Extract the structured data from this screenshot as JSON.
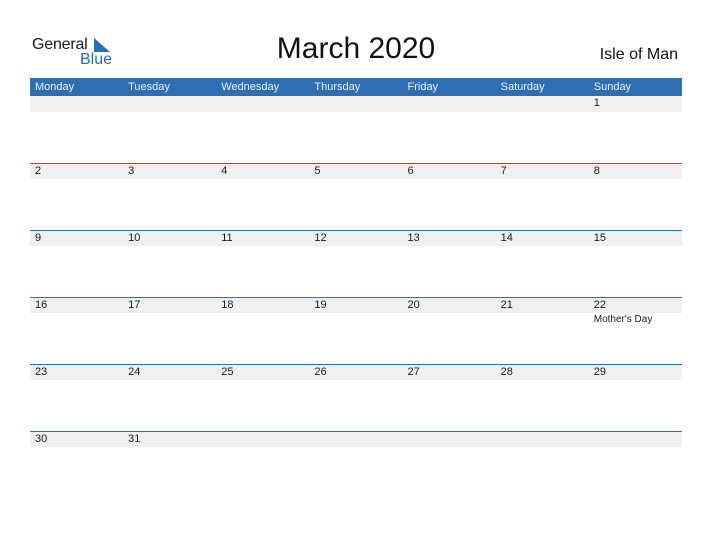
{
  "logo": {
    "general": "General",
    "blue": "Blue",
    "icon": "triangle-flag-icon"
  },
  "title": "March 2020",
  "region": "Isle of Man",
  "colors": {
    "accent": "#2e6fb3",
    "band": "#f0f0f0"
  },
  "weekdays": [
    "Monday",
    "Tuesday",
    "Wednesday",
    "Thursday",
    "Friday",
    "Saturday",
    "Sunday"
  ],
  "weeks": [
    {
      "days": [
        {
          "num": ""
        },
        {
          "num": ""
        },
        {
          "num": ""
        },
        {
          "num": ""
        },
        {
          "num": ""
        },
        {
          "num": ""
        },
        {
          "num": "1"
        }
      ]
    },
    {
      "days": [
        {
          "num": "2"
        },
        {
          "num": "3"
        },
        {
          "num": "4"
        },
        {
          "num": "5"
        },
        {
          "num": "6"
        },
        {
          "num": "7"
        },
        {
          "num": "8"
        }
      ]
    },
    {
      "days": [
        {
          "num": "9"
        },
        {
          "num": "10"
        },
        {
          "num": "11"
        },
        {
          "num": "12"
        },
        {
          "num": "13"
        },
        {
          "num": "14"
        },
        {
          "num": "15"
        }
      ]
    },
    {
      "days": [
        {
          "num": "16"
        },
        {
          "num": "17"
        },
        {
          "num": "18"
        },
        {
          "num": "19"
        },
        {
          "num": "20"
        },
        {
          "num": "21"
        },
        {
          "num": "22",
          "holiday": "Mother's Day"
        }
      ]
    },
    {
      "days": [
        {
          "num": "23"
        },
        {
          "num": "24"
        },
        {
          "num": "25"
        },
        {
          "num": "26"
        },
        {
          "num": "27"
        },
        {
          "num": "28"
        },
        {
          "num": "29"
        }
      ]
    },
    {
      "days": [
        {
          "num": "30"
        },
        {
          "num": "31"
        },
        {
          "num": ""
        },
        {
          "num": ""
        },
        {
          "num": ""
        },
        {
          "num": ""
        },
        {
          "num": ""
        }
      ]
    }
  ]
}
